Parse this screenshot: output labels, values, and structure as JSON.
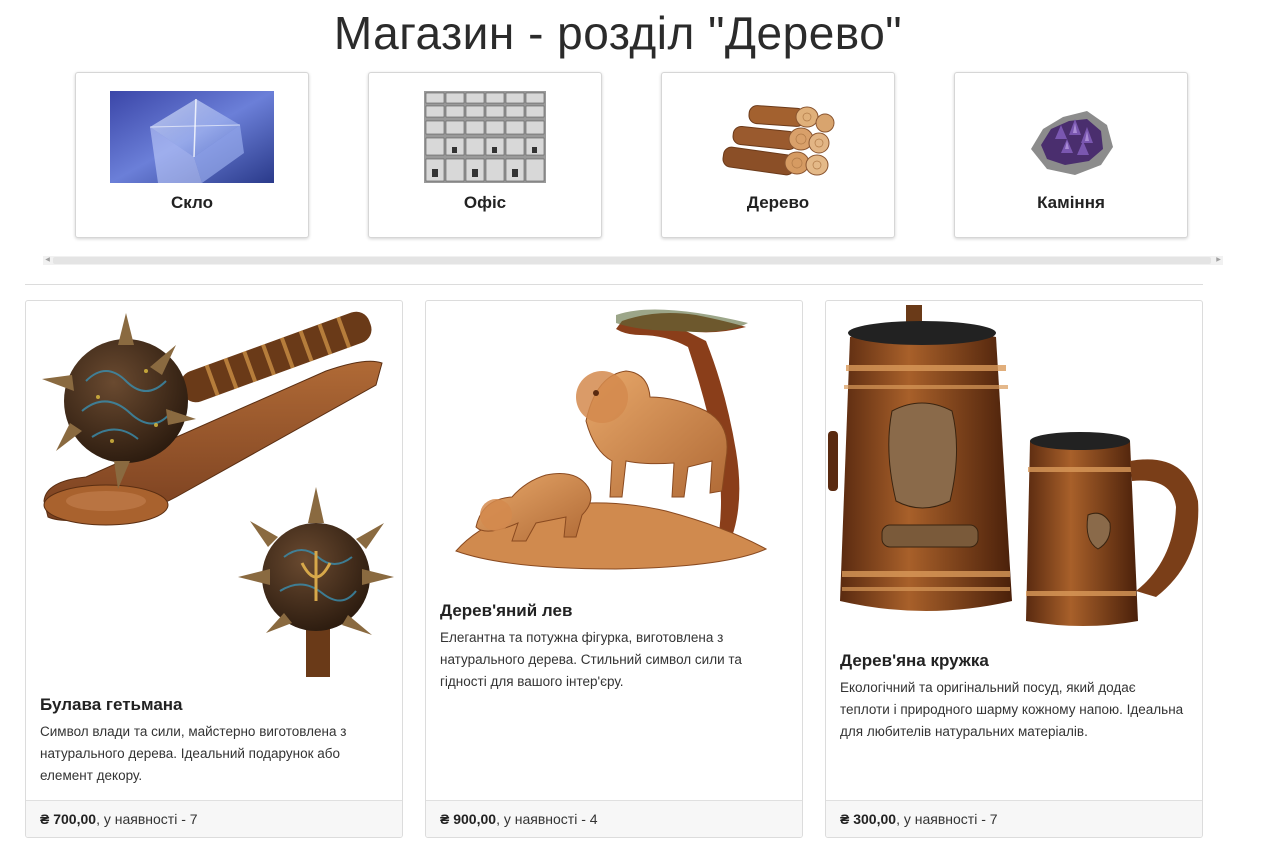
{
  "page": {
    "title": "Магазин - розділ \"Дерево\""
  },
  "categories": [
    {
      "label": "Скло",
      "icon": "glass-cube-image"
    },
    {
      "label": "Офіс",
      "icon": "office-cubicles-image"
    },
    {
      "label": "Дерево",
      "icon": "firewood-image"
    },
    {
      "label": "Каміння",
      "icon": "amethyst-image"
    }
  ],
  "products": [
    {
      "name": "Булава гетьмана",
      "description": "Символ влади та сили, майстерно виготовлена з натурального дерева. Ідеальний подарунок або елемент декору.",
      "price": "₴ 700,00",
      "stock": ", у наявності - 7",
      "image": "mace-image"
    },
    {
      "name": "Дерев'яний лев",
      "description": "Елегантна та потужна фігурка, виготовлена з натурального дерева. Стильний символ сили та гідності для вашого інтер'єру.",
      "price": "₴ 900,00",
      "stock": ", у наявності - 4",
      "image": "wooden-lion-image"
    },
    {
      "name": "Дерев'яна кружка",
      "description": "Екологічний та оригінальний посуд, який додає теплоти і природного шарму кожному напою. Ідеальна для любителів натуральних матеріалів.",
      "price": "₴ 300,00",
      "stock": ", у наявності - 7",
      "image": "wooden-mugs-image"
    }
  ]
}
